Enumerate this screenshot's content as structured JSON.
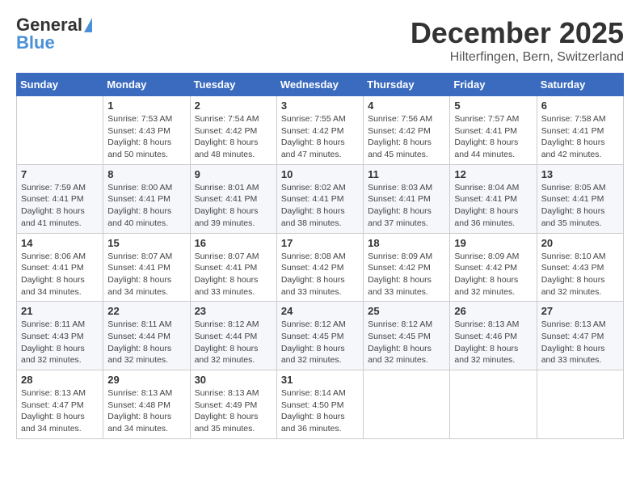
{
  "header": {
    "logo": {
      "general": "General",
      "blue": "Blue"
    },
    "title": "December 2025",
    "location": "Hilterfingen, Bern, Switzerland"
  },
  "calendar": {
    "days_of_week": [
      "Sunday",
      "Monday",
      "Tuesday",
      "Wednesday",
      "Thursday",
      "Friday",
      "Saturday"
    ],
    "weeks": [
      [
        {
          "day": "",
          "sunrise": "",
          "sunset": "",
          "daylight": ""
        },
        {
          "day": "1",
          "sunrise": "Sunrise: 7:53 AM",
          "sunset": "Sunset: 4:43 PM",
          "daylight": "Daylight: 8 hours and 50 minutes."
        },
        {
          "day": "2",
          "sunrise": "Sunrise: 7:54 AM",
          "sunset": "Sunset: 4:42 PM",
          "daylight": "Daylight: 8 hours and 48 minutes."
        },
        {
          "day": "3",
          "sunrise": "Sunrise: 7:55 AM",
          "sunset": "Sunset: 4:42 PM",
          "daylight": "Daylight: 8 hours and 47 minutes."
        },
        {
          "day": "4",
          "sunrise": "Sunrise: 7:56 AM",
          "sunset": "Sunset: 4:42 PM",
          "daylight": "Daylight: 8 hours and 45 minutes."
        },
        {
          "day": "5",
          "sunrise": "Sunrise: 7:57 AM",
          "sunset": "Sunset: 4:41 PM",
          "daylight": "Daylight: 8 hours and 44 minutes."
        },
        {
          "day": "6",
          "sunrise": "Sunrise: 7:58 AM",
          "sunset": "Sunset: 4:41 PM",
          "daylight": "Daylight: 8 hours and 42 minutes."
        }
      ],
      [
        {
          "day": "7",
          "sunrise": "Sunrise: 7:59 AM",
          "sunset": "Sunset: 4:41 PM",
          "daylight": "Daylight: 8 hours and 41 minutes."
        },
        {
          "day": "8",
          "sunrise": "Sunrise: 8:00 AM",
          "sunset": "Sunset: 4:41 PM",
          "daylight": "Daylight: 8 hours and 40 minutes."
        },
        {
          "day": "9",
          "sunrise": "Sunrise: 8:01 AM",
          "sunset": "Sunset: 4:41 PM",
          "daylight": "Daylight: 8 hours and 39 minutes."
        },
        {
          "day": "10",
          "sunrise": "Sunrise: 8:02 AM",
          "sunset": "Sunset: 4:41 PM",
          "daylight": "Daylight: 8 hours and 38 minutes."
        },
        {
          "day": "11",
          "sunrise": "Sunrise: 8:03 AM",
          "sunset": "Sunset: 4:41 PM",
          "daylight": "Daylight: 8 hours and 37 minutes."
        },
        {
          "day": "12",
          "sunrise": "Sunrise: 8:04 AM",
          "sunset": "Sunset: 4:41 PM",
          "daylight": "Daylight: 8 hours and 36 minutes."
        },
        {
          "day": "13",
          "sunrise": "Sunrise: 8:05 AM",
          "sunset": "Sunset: 4:41 PM",
          "daylight": "Daylight: 8 hours and 35 minutes."
        }
      ],
      [
        {
          "day": "14",
          "sunrise": "Sunrise: 8:06 AM",
          "sunset": "Sunset: 4:41 PM",
          "daylight": "Daylight: 8 hours and 34 minutes."
        },
        {
          "day": "15",
          "sunrise": "Sunrise: 8:07 AM",
          "sunset": "Sunset: 4:41 PM",
          "daylight": "Daylight: 8 hours and 34 minutes."
        },
        {
          "day": "16",
          "sunrise": "Sunrise: 8:07 AM",
          "sunset": "Sunset: 4:41 PM",
          "daylight": "Daylight: 8 hours and 33 minutes."
        },
        {
          "day": "17",
          "sunrise": "Sunrise: 8:08 AM",
          "sunset": "Sunset: 4:42 PM",
          "daylight": "Daylight: 8 hours and 33 minutes."
        },
        {
          "day": "18",
          "sunrise": "Sunrise: 8:09 AM",
          "sunset": "Sunset: 4:42 PM",
          "daylight": "Daylight: 8 hours and 33 minutes."
        },
        {
          "day": "19",
          "sunrise": "Sunrise: 8:09 AM",
          "sunset": "Sunset: 4:42 PM",
          "daylight": "Daylight: 8 hours and 32 minutes."
        },
        {
          "day": "20",
          "sunrise": "Sunrise: 8:10 AM",
          "sunset": "Sunset: 4:43 PM",
          "daylight": "Daylight: 8 hours and 32 minutes."
        }
      ],
      [
        {
          "day": "21",
          "sunrise": "Sunrise: 8:11 AM",
          "sunset": "Sunset: 4:43 PM",
          "daylight": "Daylight: 8 hours and 32 minutes."
        },
        {
          "day": "22",
          "sunrise": "Sunrise: 8:11 AM",
          "sunset": "Sunset: 4:44 PM",
          "daylight": "Daylight: 8 hours and 32 minutes."
        },
        {
          "day": "23",
          "sunrise": "Sunrise: 8:12 AM",
          "sunset": "Sunset: 4:44 PM",
          "daylight": "Daylight: 8 hours and 32 minutes."
        },
        {
          "day": "24",
          "sunrise": "Sunrise: 8:12 AM",
          "sunset": "Sunset: 4:45 PM",
          "daylight": "Daylight: 8 hours and 32 minutes."
        },
        {
          "day": "25",
          "sunrise": "Sunrise: 8:12 AM",
          "sunset": "Sunset: 4:45 PM",
          "daylight": "Daylight: 8 hours and 32 minutes."
        },
        {
          "day": "26",
          "sunrise": "Sunrise: 8:13 AM",
          "sunset": "Sunset: 4:46 PM",
          "daylight": "Daylight: 8 hours and 32 minutes."
        },
        {
          "day": "27",
          "sunrise": "Sunrise: 8:13 AM",
          "sunset": "Sunset: 4:47 PM",
          "daylight": "Daylight: 8 hours and 33 minutes."
        }
      ],
      [
        {
          "day": "28",
          "sunrise": "Sunrise: 8:13 AM",
          "sunset": "Sunset: 4:47 PM",
          "daylight": "Daylight: 8 hours and 34 minutes."
        },
        {
          "day": "29",
          "sunrise": "Sunrise: 8:13 AM",
          "sunset": "Sunset: 4:48 PM",
          "daylight": "Daylight: 8 hours and 34 minutes."
        },
        {
          "day": "30",
          "sunrise": "Sunrise: 8:13 AM",
          "sunset": "Sunset: 4:49 PM",
          "daylight": "Daylight: 8 hours and 35 minutes."
        },
        {
          "day": "31",
          "sunrise": "Sunrise: 8:14 AM",
          "sunset": "Sunset: 4:50 PM",
          "daylight": "Daylight: 8 hours and 36 minutes."
        },
        {
          "day": "",
          "sunrise": "",
          "sunset": "",
          "daylight": ""
        },
        {
          "day": "",
          "sunrise": "",
          "sunset": "",
          "daylight": ""
        },
        {
          "day": "",
          "sunrise": "",
          "sunset": "",
          "daylight": ""
        }
      ]
    ]
  }
}
